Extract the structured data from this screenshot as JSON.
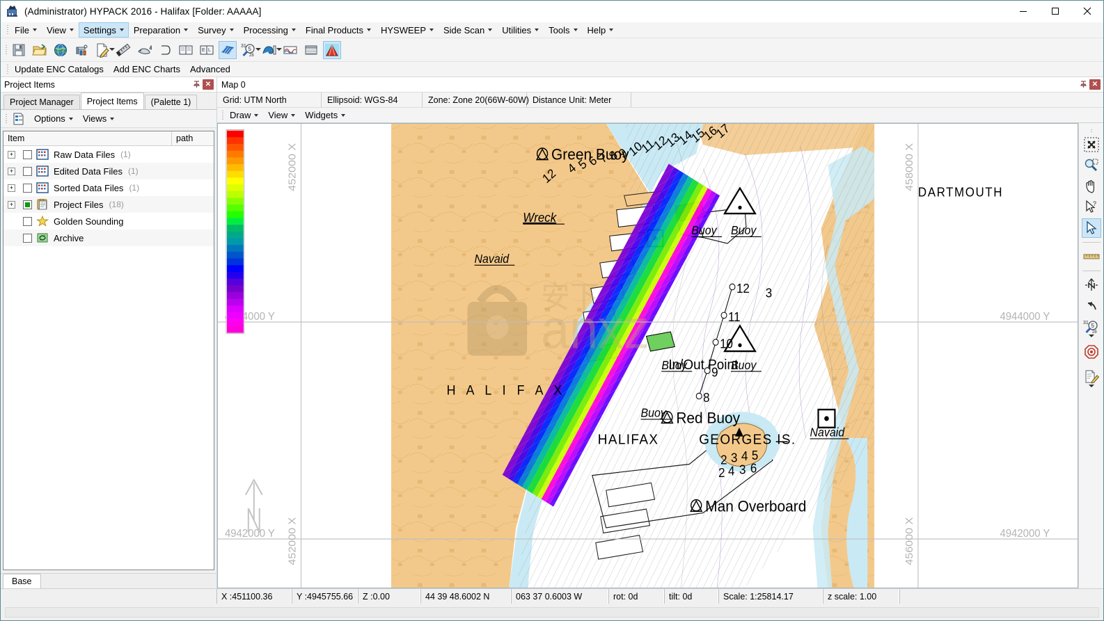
{
  "window": {
    "title": "(Administrator) HYPACK 2016 - Halifax  [Folder: AAAAA]",
    "app_icon": "hypack-icon",
    "minimize": "minimize-button",
    "maximize": "maximize-button",
    "close": "close-button"
  },
  "menubar": {
    "items": [
      {
        "label": "File",
        "active": false
      },
      {
        "label": "View",
        "active": false
      },
      {
        "label": "Settings",
        "active": true
      },
      {
        "label": "Preparation",
        "active": false
      },
      {
        "label": "Survey",
        "active": false
      },
      {
        "label": "Processing",
        "active": false
      },
      {
        "label": "Final Products",
        "active": false
      },
      {
        "label": "HYSWEEP",
        "active": false
      },
      {
        "label": "Side Scan",
        "active": false
      },
      {
        "label": "Utilities",
        "active": false
      },
      {
        "label": "Tools",
        "active": false
      },
      {
        "label": "Help",
        "active": false
      }
    ]
  },
  "toolbar": {
    "buttons": [
      {
        "name": "save-icon"
      },
      {
        "name": "open-folder-icon"
      },
      {
        "name": "globe-icon"
      },
      {
        "name": "survey-equipment-icon"
      },
      {
        "name": "edit-document-icon",
        "dropdown": true
      },
      {
        "name": "ruler-icon"
      },
      {
        "name": "whale-icon"
      },
      {
        "name": "shape-icon"
      },
      {
        "name": "book-icon"
      },
      {
        "name": "book-edit-icon"
      },
      {
        "name": "matrix-icon",
        "selected": true
      },
      {
        "name": "date-search-icon",
        "dropdown": true
      },
      {
        "name": "wave-icon",
        "dropdown": true
      },
      {
        "name": "tide-icon"
      },
      {
        "name": "blinds-icon"
      },
      {
        "name": "tin-model-icon",
        "selected": true
      }
    ]
  },
  "encbar": {
    "items": [
      "Update ENC Catalogs",
      "Add ENC Charts",
      "Advanced"
    ]
  },
  "left_dock": {
    "header": {
      "title": "Project Items",
      "pin": "pin-icon",
      "close": "close-icon"
    },
    "tabs": [
      {
        "label": "Project Manager",
        "active": false
      },
      {
        "label": "Project Items",
        "active": true
      },
      {
        "label": "(Palette 1)",
        "active": false
      }
    ],
    "options_bar": {
      "icon": "project-options-icon",
      "items": [
        {
          "label": "Options",
          "dropdown": true
        },
        {
          "label": "Views",
          "dropdown": true
        }
      ]
    },
    "tree": {
      "columns": [
        "Item",
        "path"
      ],
      "rows": [
        {
          "label": "Raw Data Files",
          "count": "(1)",
          "checked": false,
          "expandable": true,
          "icon": "data-grid-icon"
        },
        {
          "label": "Edited Data Files",
          "count": "(1)",
          "checked": false,
          "expandable": true,
          "icon": "data-grid-icon"
        },
        {
          "label": "Sorted Data Files",
          "count": "(1)",
          "checked": false,
          "expandable": true,
          "icon": "data-grid-icon"
        },
        {
          "label": "Project Files",
          "count": "(18)",
          "checked": true,
          "expandable": true,
          "icon": "clipboard-icon"
        },
        {
          "label": "Golden Sounding",
          "count": "",
          "checked": false,
          "expandable": false,
          "icon": "star-icon"
        },
        {
          "label": "Archive",
          "count": "",
          "checked": false,
          "expandable": false,
          "icon": "archive-icon"
        }
      ]
    },
    "bottom_tab": "Base"
  },
  "map_dock": {
    "title": "Map 0",
    "pin": "pin-icon",
    "close": "close-icon",
    "info": [
      "Grid: UTM North",
      "Ellipsoid: WGS-84",
      "Zone: Zone 20(66W-60W)",
      "Distance Unit: Meter"
    ],
    "menu": [
      {
        "label": "Draw",
        "dropdown": true
      },
      {
        "label": "View",
        "dropdown": true
      },
      {
        "label": "Widgets",
        "dropdown": true
      }
    ],
    "grid_labels": {
      "x_left": "452000 X",
      "x_right": "458000 X",
      "x_bottom_left": "452000 X",
      "x_bottom_right": "456000 X",
      "y_upper_left": "4944000 Y",
      "y_upper_right": "4944000 Y",
      "y_lower_left": "4942000 Y",
      "y_lower_right": "4942000 Y"
    },
    "map_labels": [
      "Green Buoy",
      "DARTMOUTH",
      "Wreck",
      "Navaid",
      "Buoy",
      "Buoy",
      "Buoy",
      "Buoy",
      "Buoy",
      "HALIFAX",
      "Red Buoy",
      "GEORGES IS.",
      "HALIFAX",
      "In/Out Point",
      "Man Overboard",
      "Navaid"
    ],
    "sounding_numbers": [
      "12",
      "4",
      "5",
      "6",
      "7",
      "8",
      "9",
      "10",
      "11",
      "12",
      "13",
      "14",
      "15",
      "16",
      "17",
      "3",
      "8",
      "9",
      "10",
      "11",
      "12"
    ],
    "north_arrow": "north-arrow-icon",
    "watermark": "anxz-watermark",
    "colorbar": {
      "name": "depth-color-palette",
      "colors": [
        "#ff0000",
        "#ff3300",
        "#ff5500",
        "#ff7b00",
        "#ff9900",
        "#ffbb00",
        "#ffdd00",
        "#ffff00",
        "#ddff00",
        "#bbff00",
        "#88ff00",
        "#55ff00",
        "#22ff00",
        "#00ee44",
        "#00bb66",
        "#00aa88",
        "#0099aa",
        "#0077bb",
        "#0055cc",
        "#0033dd",
        "#0000ff",
        "#2200ee",
        "#5500dd",
        "#7700cc",
        "#9900dd",
        "#bb00ee",
        "#dd00ff",
        "#ee00ff",
        "#ff00ee",
        "#ff00dd"
      ]
    }
  },
  "right_tools": [
    {
      "name": "zoom-extents-icon",
      "selected": false
    },
    {
      "name": "zoom-window-icon",
      "selected": false
    },
    {
      "name": "pan-hand-icon",
      "selected": false
    },
    {
      "name": "query-pointer-icon",
      "selected": false
    },
    {
      "name": "select-pointer-icon",
      "selected": true
    },
    {
      "name": "ruler-measure-icon",
      "selected": false
    },
    {
      "name": "north-arrow-icon",
      "selected": false
    },
    {
      "name": "undo-arrow-icon",
      "selected": false
    },
    {
      "name": "date-search-icon",
      "selected": false,
      "dropdown": true
    },
    {
      "name": "target-icon",
      "selected": false
    },
    {
      "name": "edit-note-icon",
      "selected": false,
      "dropdown": true
    }
  ],
  "statusbar": {
    "cells": [
      "X :451100.36",
      "Y :4945755.66",
      "Z :0.00",
      "44 39 48.6002 N",
      "063 37 0.6003 W",
      "rot:  0d",
      "tilt:  0d",
      "Scale: 1:25814.17",
      "z scale: 1.00"
    ]
  },
  "colors": {
    "accent": "#cde6f7",
    "accent_border": "#8fc1e3",
    "land": "#f3c98b",
    "shallow_water": "#c9eaf4",
    "window_border": "#5a8a95",
    "close_red": "#b05050"
  }
}
